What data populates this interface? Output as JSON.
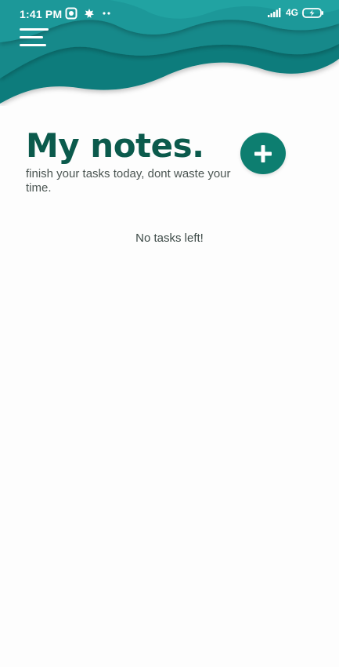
{
  "status_bar": {
    "time": "1:41 PM",
    "network": "4G"
  },
  "header": {
    "menu_icon": "hamburger-menu-icon"
  },
  "main": {
    "title": "My notes.",
    "subtitle": "finish your tasks today, dont waste your time.",
    "add_button_icon": "plus-icon",
    "empty_message": "No tasks left!"
  },
  "colors": {
    "primary": "#0d7e70",
    "title": "#0b5a4c",
    "wave_dark": "#0e7c7b",
    "wave_mid": "#13898a",
    "wave_light": "#1a9899",
    "background": "#fdfdfd"
  }
}
